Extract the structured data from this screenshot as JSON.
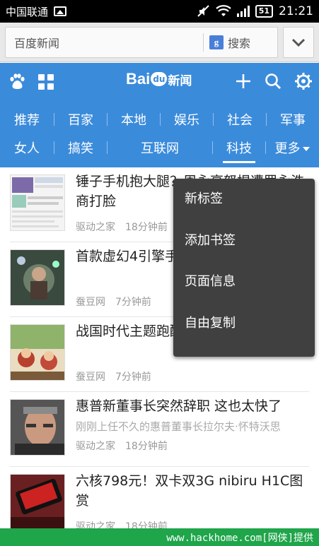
{
  "status": {
    "carrier": "中国联通",
    "battery": "51",
    "time": "21:21"
  },
  "browser": {
    "url": "百度新闻",
    "search_engine": "g",
    "search_label": "搜索"
  },
  "header": {
    "logo_bai": "Bai",
    "logo_du": "du",
    "logo_news": "新闻"
  },
  "tabs_row1": [
    "推荐",
    "百家",
    "本地",
    "娱乐",
    "社会",
    "军事"
  ],
  "tabs_row2": [
    "女人",
    "搞笑",
    "互联网",
    "科技",
    "更多"
  ],
  "active_tab": "科技",
  "news": [
    {
      "title": "锤子手机抱大腿？周永亮怒揭遭罗永浩商打脸",
      "sub": "",
      "source": "驱动之家",
      "time": "18分钟前"
    },
    {
      "title": "首款虚幻4引擎手游《 》发布",
      "sub": "",
      "source": "蚕豆网",
      "time": "7分钟前"
    },
    {
      "title": "战国时代主题跑酷手游登陆双平台上架",
      "sub": "",
      "source": "蚕豆网",
      "time": "7分钟前"
    },
    {
      "title": "惠普新董事长突然辞职 这也太快了",
      "sub": "刚刚上任不久的惠普董事长拉尔夫·怀特沃思",
      "source": "驱动之家",
      "time": "18分钟前"
    },
    {
      "title": "六核798元！双卡双3G nibiru H1C图赏",
      "sub": "",
      "source": "驱动之家",
      "time": "18分钟前"
    }
  ],
  "popup_menu": [
    "新标签",
    "添加书签",
    "页面信息",
    "自由复制"
  ],
  "footer": "www.hackhome.com[网侠]提供",
  "colors": {
    "header_blue": "#3b8bdb",
    "footer_green": "#1fa54a",
    "popup_bg": "#404040"
  }
}
